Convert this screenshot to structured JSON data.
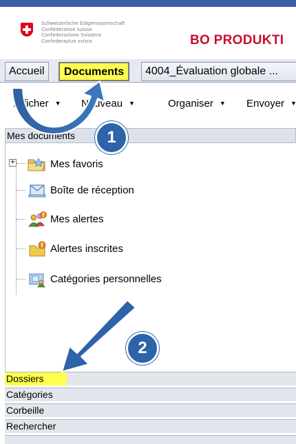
{
  "header": {
    "confederation_lines": [
      "Schweizerische Eidgenossenschaft",
      "Confédération suisse",
      "Confederazione Svizzera",
      "Confederaziun svizra"
    ],
    "brand": "BO PRODUKTI"
  },
  "tabs": [
    {
      "label": "Accueil"
    },
    {
      "label": "Documents"
    },
    {
      "label": "4004_Évaluation globale ..."
    }
  ],
  "toolbar": {
    "items": [
      {
        "label": "Afficher"
      },
      {
        "label": "Nouveau"
      },
      {
        "label": "Organiser"
      },
      {
        "label": "Envoyer"
      }
    ],
    "caret": "▼"
  },
  "panel": {
    "title": "Mes documents",
    "tree": [
      {
        "label": "Mes favoris",
        "icon": "folder-favorites-icon",
        "expander": "+"
      },
      {
        "label": "Boîte de réception",
        "icon": "inbox-icon"
      },
      {
        "label": "Mes alertes",
        "icon": "alerts-icon"
      },
      {
        "label": "Alertes inscrites",
        "icon": "subscribed-alerts-icon"
      },
      {
        "label": "Catégories personnelles",
        "icon": "personal-categories-icon"
      }
    ]
  },
  "sections": [
    {
      "label": "Dossiers",
      "highlighted": true
    },
    {
      "label": "Catégories"
    },
    {
      "label": "Corbeille"
    },
    {
      "label": "Rechercher"
    }
  ],
  "annotations": {
    "step1": "1",
    "step2": "2",
    "color": "#2e63a8",
    "highlight": "#ffff4f"
  }
}
